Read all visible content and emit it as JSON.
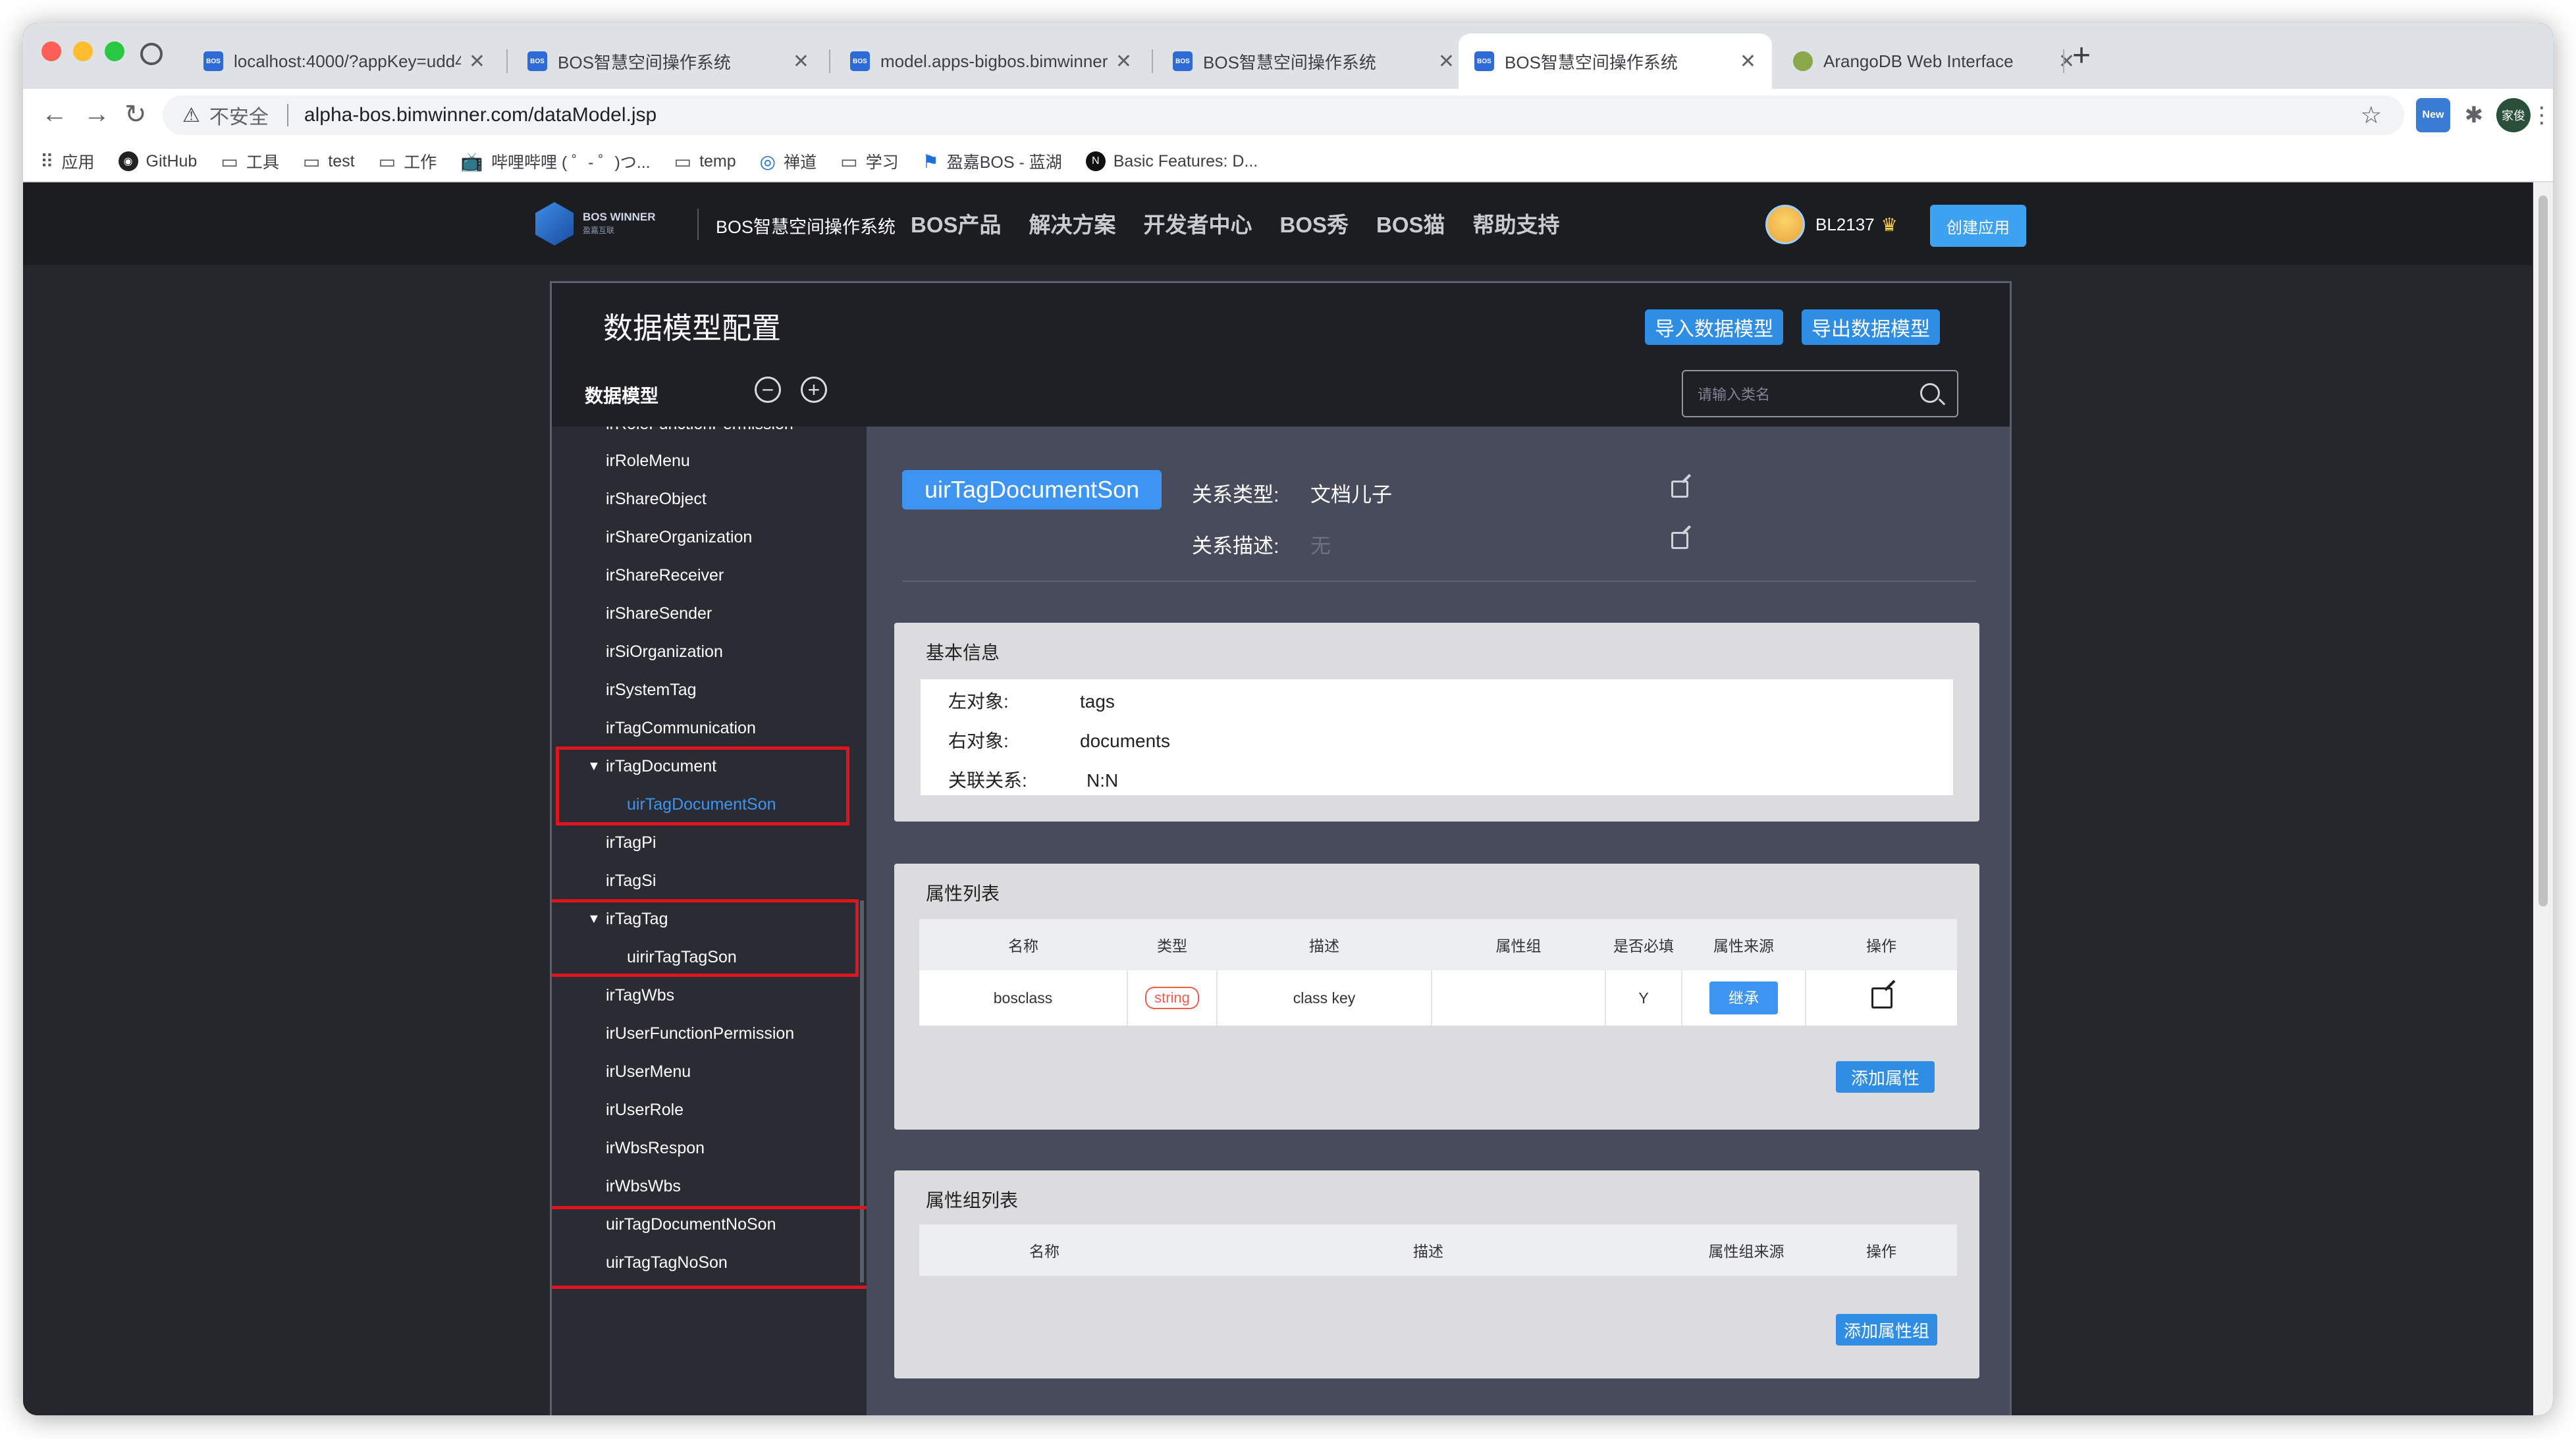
{
  "browser": {
    "tabs": [
      {
        "favicon": "BOS",
        "title": "localhost:4000/?appKey=udd4"
      },
      {
        "favicon": "BOS",
        "title": "BOS智慧空间操作系统"
      },
      {
        "favicon": "BOS",
        "title": "model.apps-bigbos.bimwinner"
      },
      {
        "favicon": "BOS",
        "title": "BOS智慧空间操作系统"
      },
      {
        "favicon": "BOS",
        "title": "BOS智慧空间操作系统"
      },
      {
        "favicon": "",
        "title": "ArangoDB Web Interface"
      }
    ],
    "security_label": "不安全",
    "url": "alpha-bos.bimwinner.com/dataModel.jsp",
    "ext_new_label": "New",
    "profile_label": "家俊",
    "bookmarks": [
      "应用",
      "GitHub",
      "工具",
      "test",
      "工作",
      "哔哩哔哩 ( ゜- ゜)つ...",
      "temp",
      "禅道",
      "学习",
      "盈嘉BOS - 蓝湖",
      "Basic Features: D..."
    ]
  },
  "header": {
    "logo_text": "BOS WINNER",
    "logo_sub": "盈嘉互联",
    "system_name": "BOS智慧空间操作系统",
    "nav": [
      "BOS产品",
      "解决方案",
      "开发者中心",
      "BOS秀",
      "BOS猫",
      "帮助支持"
    ],
    "username": "BL2137",
    "create_app": "创建应用"
  },
  "panel": {
    "title": "数据模型配置",
    "import_label": "导入数据模型",
    "export_label": "导出数据模型",
    "tree_title": "数据模型",
    "search_placeholder": "请输入类名"
  },
  "tree": {
    "items": [
      {
        "label": "irRoleFunctionPermission",
        "child": false
      },
      {
        "label": "irRoleMenu",
        "child": false
      },
      {
        "label": "irShareObject",
        "child": false
      },
      {
        "label": "irShareOrganization",
        "child": false
      },
      {
        "label": "irShareReceiver",
        "child": false
      },
      {
        "label": "irShareSender",
        "child": false
      },
      {
        "label": "irSiOrganization",
        "child": false
      },
      {
        "label": "irSystemTag",
        "child": false
      },
      {
        "label": "irTagCommunication",
        "child": false
      },
      {
        "label": "irTagDocument",
        "child": false,
        "expanded": true
      },
      {
        "label": "uirTagDocumentSon",
        "child": true,
        "selected": true
      },
      {
        "label": "irTagPi",
        "child": false
      },
      {
        "label": "irTagSi",
        "child": false
      },
      {
        "label": "irTagTag",
        "child": false,
        "expanded": true
      },
      {
        "label": "uirirTagTagSon",
        "child": true
      },
      {
        "label": "irTagWbs",
        "child": false
      },
      {
        "label": "irUserFunctionPermission",
        "child": false
      },
      {
        "label": "irUserMenu",
        "child": false
      },
      {
        "label": "irUserRole",
        "child": false
      },
      {
        "label": "irWbsRespon",
        "child": false
      },
      {
        "label": "irWbsWbs",
        "child": false
      },
      {
        "label": "uirTagDocumentNoSon",
        "child": false
      },
      {
        "label": "uirTagTagNoSon",
        "child": false
      }
    ],
    "expanded_arrow": "▼"
  },
  "detail": {
    "relation_name": "uirTagDocumentSon",
    "type_label": "关系类型:",
    "type_value": "文档儿子",
    "desc_label": "关系描述:",
    "desc_value": "无",
    "basic": {
      "title": "基本信息",
      "rows": [
        {
          "key": "左对象:",
          "value": "tags"
        },
        {
          "key": "右对象:",
          "value": "documents"
        },
        {
          "key": "关联关系:",
          "value": "N:N"
        }
      ]
    },
    "attributes": {
      "title": "属性列表",
      "columns": [
        "名称",
        "类型",
        "描述",
        "属性组",
        "是否必填",
        "属性来源",
        "操作"
      ],
      "rows": [
        {
          "name": "bosclass",
          "type": "string",
          "desc": "class key",
          "group": "",
          "required": "Y",
          "source": "继承"
        }
      ],
      "add_label": "添加属性"
    },
    "groups": {
      "title": "属性组列表",
      "columns": [
        "名称",
        "描述",
        "属性组来源",
        "操作"
      ],
      "add_label": "添加属性组"
    }
  }
}
